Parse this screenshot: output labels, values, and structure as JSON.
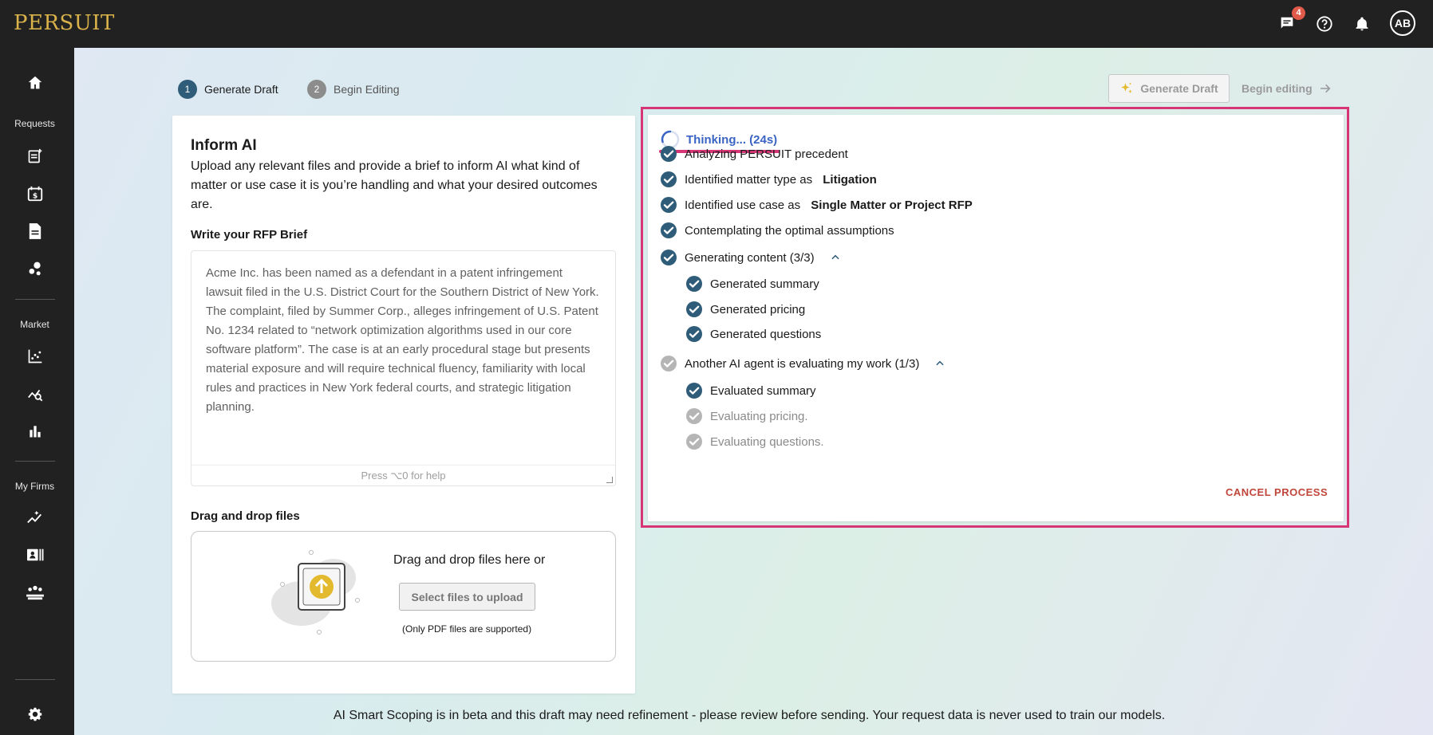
{
  "brand": {
    "logo": "PERSUIT"
  },
  "topbar": {
    "messages_badge": "4",
    "avatar_initials": "AB"
  },
  "sidebar": {
    "sections": {
      "requests": "Requests",
      "market": "Market",
      "my_firms": "My Firms"
    }
  },
  "steps": [
    {
      "num": "1",
      "label": "Generate Draft"
    },
    {
      "num": "2",
      "label": "Begin Editing"
    }
  ],
  "actions": {
    "generate_draft": "Generate Draft",
    "begin_editing": "Begin editing"
  },
  "inform": {
    "title": "Inform AI",
    "description": "Upload any relevant files and provide a brief to inform AI what kind of matter or use case it is you’re handling and what your desired outcomes are.",
    "brief_label": "Write your RFP Brief",
    "brief_text": "Acme Inc. has been named as a defendant in a patent infringement lawsuit filed in the U.S. District Court for the Southern District of New York. The complaint, filed by Summer Corp., alleges infringement of U.S. Patent No. 1234 related to “network optimization algorithms used in our core software platform”. The case is at an early procedural stage but presents material exposure and will require technical fluency, familiarity with local rules and practices in New York federal courts, and strategic litigation planning.",
    "brief_help": "Press ⌥0 for help",
    "dropzone_label": "Drag and drop files",
    "dropzone_text": "Drag and drop files here or",
    "upload_button": "Select files to upload",
    "upload_note": "(Only PDF files are supported)"
  },
  "progress": {
    "thinking": "Thinking... (24s)",
    "tasks": [
      {
        "text": "Analyzing PERSUIT precedent",
        "bold": "",
        "done": true,
        "indent": 0
      },
      {
        "text": "Identified matter type as ",
        "bold": "Litigation",
        "done": true,
        "indent": 0
      },
      {
        "text": "Identified use case as ",
        "bold": "Single Matter or Project RFP",
        "done": true,
        "indent": 0
      },
      {
        "text": "Contemplating the optimal assumptions",
        "bold": "",
        "done": true,
        "indent": 0
      },
      {
        "text": "Generating content (3/3)",
        "bold": "",
        "done": true,
        "indent": 0,
        "expand": true
      },
      {
        "text": "Generated summary",
        "bold": "",
        "done": true,
        "indent": 1
      },
      {
        "text": "Generated pricing",
        "bold": "",
        "done": true,
        "indent": 1
      },
      {
        "text": "Generated questions",
        "bold": "",
        "done": true,
        "indent": 1
      },
      {
        "text": "Another AI agent is evaluating my work (1/3)",
        "bold": "",
        "done": false,
        "indent": 0,
        "expand": true
      },
      {
        "text": "Evaluated summary",
        "bold": "",
        "done": true,
        "indent": 1
      },
      {
        "text": "Evaluating pricing.",
        "bold": "",
        "done": false,
        "indent": 1
      },
      {
        "text": "Evaluating questions.",
        "bold": "",
        "done": false,
        "indent": 1
      }
    ],
    "cancel": "CANCEL PROCESS"
  },
  "footer": {
    "disclaimer": "AI Smart Scoping is in beta and this draft may need refinement - please review before sending. Your request data is never used to train our models."
  },
  "colors": {
    "accent_blue": "#3a64c4",
    "check_done": "#2f5c78",
    "check_pending": "#b5b5b5",
    "highlight": "#d63675",
    "cancel": "#c0453a",
    "logo": "#d9b24a"
  }
}
